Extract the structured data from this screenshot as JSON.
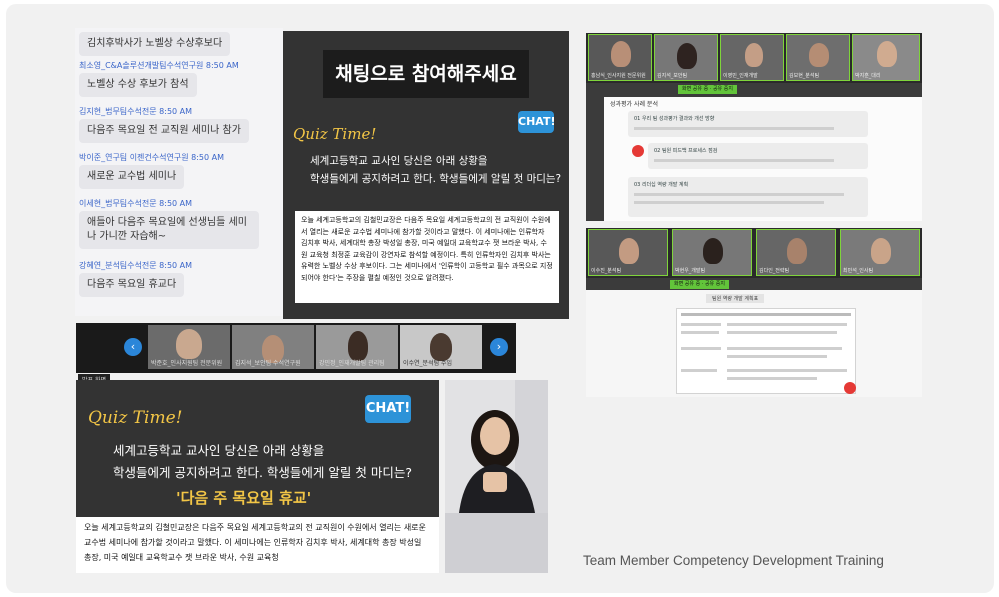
{
  "chat": {
    "messages": [
      {
        "sender": "",
        "text": "김치후박사가 노벨상 수상후보다"
      },
      {
        "sender": "최소영_C&A솔루션개발팀수석연구원",
        "time": "8:50 AM",
        "text": "노벨상 수상 후보가 참석"
      },
      {
        "sender": "김지현_법무팀수석전문",
        "time": "8:50 AM",
        "text": "다음주 목요일 전 교직원 세미나 참가"
      },
      {
        "sender": "박이준_연구팀 이젠건수석연구원",
        "time": "8:50 AM",
        "text": "새로운 교수법 세미나"
      },
      {
        "sender": "이세현_법무팀수석전문",
        "time": "8:50 AM",
        "text": "애들아 다음주 목요일에 선생님들 세미나 가니깐 자습해~"
      },
      {
        "sender": "강혜연_분석팀수석전문",
        "time": "8:50 AM",
        "text": "다음주 목요일 휴교다"
      }
    ]
  },
  "slide_top": {
    "title": "채팅으로 참여해주세요",
    "quiz_label": "Quiz Time!",
    "badge": "CHAT!",
    "question_1": "세계고등학교 교사인 당신은 아래 상황을",
    "question_2": "학생들에게 공지하려고 한다. 학생들에게 알릴 첫 마디는?",
    "body": "오늘 세계고등학교의 김철민교장은 다음주 목요일 세계고등학교의 전 교직원이 수원에서 열리는 새로운 교수법 세미나에 참가할 것이라고 말했다. 이 세미나에는 인류학자 김치후 박사, 세계대학 총장 박성일 총장, 미국 예일대 교육학교수 잿 브라운 박사, 수원 교육청 최정훈 교육감이 강연자로 참석할 예정이다. 특히 인류학자인 김치후 박사는 유력한 노벨상 수상 후보이다. 그는 세미나에서 '인류학이 고등학교 필수 과목으로 지정되어야 한다'는 주장을 펼칠 예정인 것으로 알려졌다."
  },
  "strip": {
    "prev_icon": "chevron-left-icon",
    "next_icon": "chevron-right-icon",
    "participants": [
      "박준호_인사지원팀 전문위원",
      "김지석_보안팀 수석연구원",
      "강민정_인재개발팀 관리팀",
      "이수연_분석팀 주임",
      "최다희_분석팀 선임"
    ]
  },
  "speaker_label": "발표 화면",
  "slide_bottom": {
    "quiz_label": "Quiz Time!",
    "badge": "CHAT!",
    "question_1": "세계고등학교 교사인 당신은 아래 상황을",
    "question_2": "학생들에게 공지하려고 한다. 학생들에게 알릴 첫 마디는?",
    "answer": "'다음 주 목요일 휴교'",
    "body": "오늘 세계고등학교의 김철민교장은 다음주 목요일 세계고등학교의 전 교직원이 수원에서 열리는 새로운 교수법 세미나에 참가할 것이라고 말했다. 이 세미나에는 인류학자 김치후 박사, 세계대학 총장 박성일 총장, 미국 예일대 교육학교수 잿 브라운 박사, 수원 교육청"
  },
  "zoom_top": {
    "participants": [
      "홍남식_인사지원 전문위원",
      "김지석_보안팀",
      "이영민_인재개발",
      "김보현_분석팀",
      "박지훈_대리"
    ],
    "share_banner": "화면 공유 중 · 공유 중지",
    "doc_title": "성과평가 사례 분석",
    "rows": [
      "01 우리 팀 성과평가 결과와 개선 방향",
      "02 팀원 피드백 프로세스 점검",
      "03 리더십 역량 개발 계획"
    ]
  },
  "zoom_bottom": {
    "participants": [
      "이수진_분석팀",
      "박현우_개발팀",
      "김다인_전략팀",
      "최민석_인사팀"
    ],
    "share_banner": "화면 공유 중 · 공유 중지",
    "doc_header": "팀원 역량 개발 계획표"
  },
  "caption": "Team Member Competency Development Training",
  "colors": {
    "chat_name": "#3a65c9",
    "slide_bg": "#333333",
    "quiz_yellow": "#f3c646",
    "chat_badge": "#2d93d8",
    "zoom_green": "#62c43a"
  }
}
